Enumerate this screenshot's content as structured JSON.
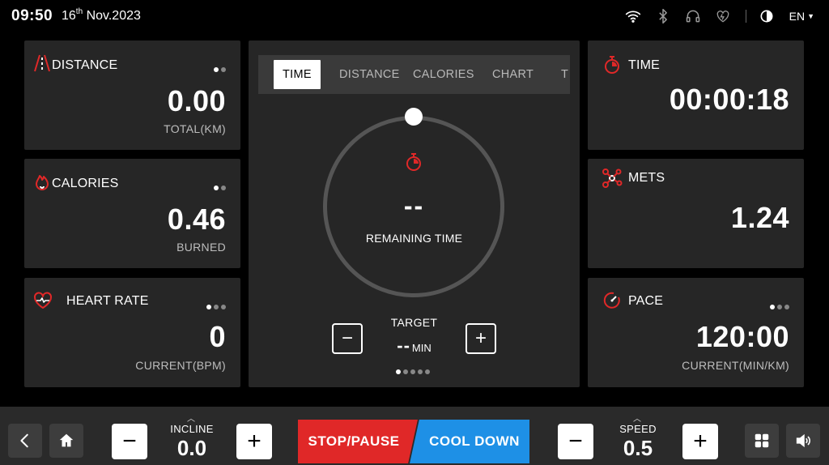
{
  "status": {
    "time": "09:50",
    "date_day": "16",
    "date_suffix": "th",
    "date_rest": "Nov.2023",
    "language": "EN",
    "icons": [
      "wifi-icon",
      "bluetooth-icon",
      "headphones-icon",
      "heart-monitor-icon",
      "contrast-icon"
    ]
  },
  "left_cards": {
    "distance": {
      "label": "DISTANCE",
      "value": "0.00",
      "unit": "TOTAL(KM)"
    },
    "calories": {
      "label": "CALORIES",
      "value": "0.46",
      "unit": "BURNED"
    },
    "heart_rate": {
      "label": "HEART RATE",
      "value": "0",
      "unit": "CURRENT(BPM)"
    }
  },
  "right_cards": {
    "time": {
      "label": "TIME",
      "value": "00:00:18"
    },
    "mets": {
      "label": "METS",
      "value": "1.24"
    },
    "pace": {
      "label": "PACE",
      "value": "120:00",
      "unit": "CURRENT(MIN/KM)"
    }
  },
  "center": {
    "tabs": [
      "TIME",
      "DISTANCE",
      "CALORIES",
      "CHART",
      "T"
    ],
    "active_tab": "TIME",
    "ring_value": "--",
    "ring_label": "REMAINING TIME",
    "target_label": "TARGET",
    "target_value": "--",
    "target_unit": "MIN"
  },
  "bottom": {
    "incline_label": "INCLINE",
    "incline_value": "0.0",
    "speed_label": "SPEED",
    "speed_value": "0.5",
    "stop_label": "STOP/PAUSE",
    "cool_label": "COOL DOWN",
    "minus": "−",
    "plus": "+"
  },
  "colors": {
    "accent_red": "#e02828",
    "accent_blue": "#1e90e6",
    "card_bg": "#262626"
  }
}
